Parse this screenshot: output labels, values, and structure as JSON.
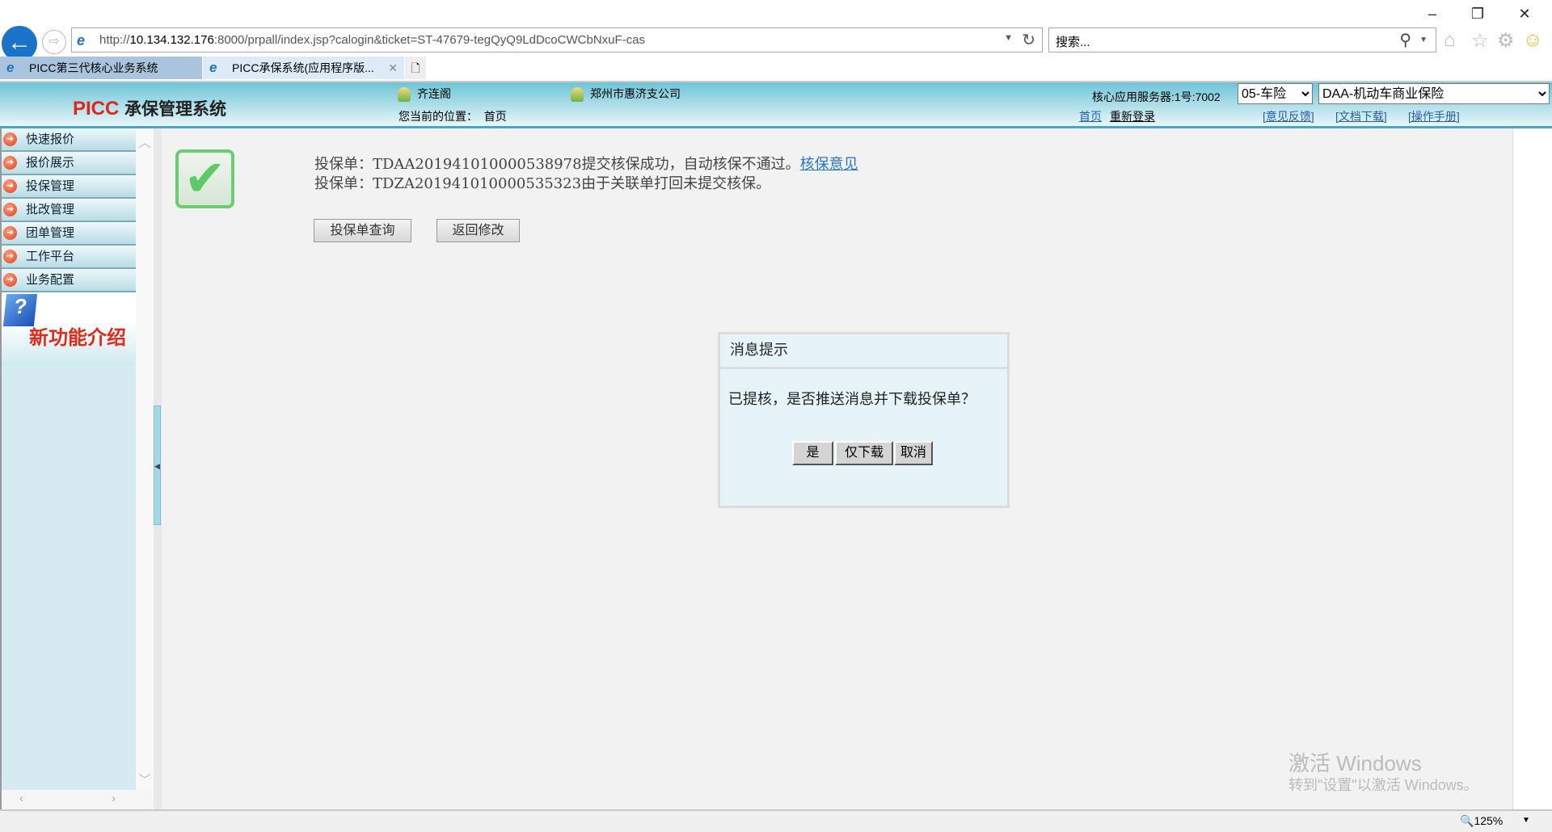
{
  "browser": {
    "url_prefix": "http://",
    "url_host": "10.134.132.176",
    "url_rest": ":8000/prpall/index.jsp?calogin&ticket=ST-47679-tegQyQ9LdDcoCWCbNxuF-cas",
    "search_placeholder": "搜索...",
    "tabs": [
      {
        "label": "PICC第三代核心业务系统",
        "active": false
      },
      {
        "label": "PICC承保系统(应用程序版...",
        "active": true
      }
    ],
    "zoom": "125%"
  },
  "header": {
    "logo_brand": "PICC",
    "logo_title": "承保管理系统",
    "user": "齐连阁",
    "org": "郑州市惠济支公司",
    "location_label": "您当前的位置：",
    "location": "首页",
    "server": "核心应用服务器:1号:7002",
    "risk_class": "05-车险",
    "product": "DAA-机动车商业保险",
    "links": {
      "home": "首页",
      "relogin": "重新登录",
      "feedback": "[意见反馈]",
      "docs": "[文档下载]",
      "manual": "[操作手册]"
    }
  },
  "sidebar": {
    "items": [
      {
        "label": "快速报价"
      },
      {
        "label": "报价展示"
      },
      {
        "label": "投保管理"
      },
      {
        "label": "批改管理"
      },
      {
        "label": "团单管理"
      },
      {
        "label": "工作平台"
      },
      {
        "label": "业务配置"
      }
    ],
    "new_features": "新功能介绍"
  },
  "main": {
    "line1_text": "投保单：TDAA201941010000538978提交核保成功，自动核保不通过。",
    "line1_link": "核保意见",
    "line2_text": "投保单：TDZA201941010000535323由于关联单打回未提交核保。",
    "query_button": "投保单查询",
    "back_button": "返回修改"
  },
  "dialog": {
    "title": "消息提示",
    "message": "已提核，是否推送消息并下载投保单？",
    "yes": "是",
    "download_only": "仅下载",
    "cancel": "取消"
  },
  "watermark": {
    "line1": "激活 Windows",
    "line2": "转到\"设置\"以激活 Windows。"
  }
}
